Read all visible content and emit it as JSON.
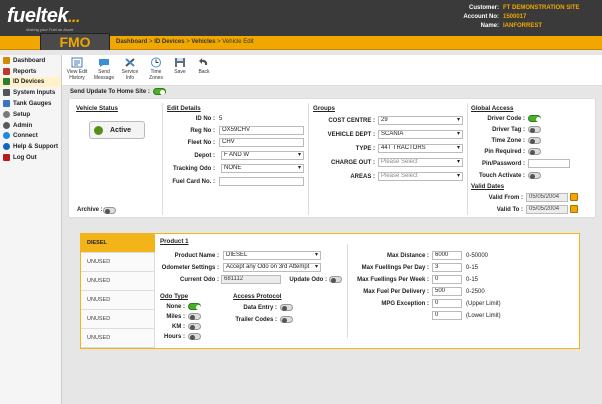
{
  "logo": {
    "text": "fueltek",
    "dots": "...",
    "tagline": "Making your Fuel an Asset"
  },
  "account": {
    "customer_label": "Customer:",
    "customer": "FT DEMONSTRATION SITE",
    "account_label": "Account No:",
    "account_no": "1500017",
    "name_label": "Name:",
    "name": "IANFORREST"
  },
  "app_tab": "FMO",
  "breadcrumb": {
    "home": "Dashboard",
    "id_devices": "ID Devices",
    "vehicles": "Vehicles",
    "current": "Vehicle Edit",
    "sep": " > "
  },
  "sidebar": [
    {
      "label": "Dashboard",
      "icon": "dashboard-icon",
      "color": "#d28a00"
    },
    {
      "label": "Reports",
      "icon": "reports-icon",
      "color": "#c0392b"
    },
    {
      "label": "ID Devices",
      "icon": "id-devices-icon",
      "color": "#2e7d32"
    },
    {
      "label": "System Inputs",
      "icon": "system-inputs-icon",
      "color": "#555555"
    },
    {
      "label": "Tank Gauges",
      "icon": "tank-gauges-icon",
      "color": "#3a75c4"
    },
    {
      "label": "Setup",
      "icon": "setup-icon",
      "color": "#7a7a7a"
    },
    {
      "label": "Admin",
      "icon": "admin-icon",
      "color": "#5a5a5a"
    },
    {
      "label": "Connect",
      "icon": "connect-icon",
      "color": "#1e88e5"
    },
    {
      "label": "Help & Support",
      "icon": "help-icon",
      "color": "#1565c0"
    },
    {
      "label": "Log Out",
      "icon": "log-out-icon",
      "color": "#b71c1c"
    }
  ],
  "toolbar": {
    "view_edit_history": [
      "View Edit",
      "History"
    ],
    "send_message": [
      "Send",
      "Message"
    ],
    "service_info": [
      "Service",
      "Info"
    ],
    "time_zones": [
      "Time",
      "Zones"
    ],
    "save": "Save",
    "back": "Back"
  },
  "send_update": {
    "label": "Send Update To Home Site :",
    "on": true
  },
  "vehicle_status": {
    "title": "Vehicle Status",
    "state": "Active",
    "archive_label": "Archive :",
    "archive_on": false
  },
  "edit_details": {
    "title": "Edit Details",
    "id_no_label": "ID No :",
    "id_no": "5",
    "reg_no_label": "Reg No :",
    "reg_no": "OX59CHV",
    "fleet_no_label": "Fleet No :",
    "fleet_no": "CHV",
    "depot_label": "Depot :",
    "depot": "F AND W",
    "tracking_odo_label": "Tracking Odo :",
    "tracking_odo": "NONE",
    "fuel_card_label": "Fuel Card No. :",
    "fuel_card": ""
  },
  "groups": {
    "title": "Groups",
    "cost_centre_label": "COST CENTRE :",
    "cost_centre": "29",
    "vehicle_dept_label": "VEHICLE DEPT :",
    "vehicle_dept": "SCANIA",
    "type_label": "TYPE :",
    "type": "44T TRACTORS",
    "charge_out_label": "CHARGE OUT :",
    "charge_out": "Please Select",
    "areas_label": "AREAS :",
    "areas": "Please Select"
  },
  "global_access": {
    "title": "Global Access",
    "driver_code_label": "Driver Code :",
    "driver_code_on": true,
    "driver_tag_label": "Driver Tag :",
    "driver_tag_on": false,
    "time_zone_label": "Time Zone :",
    "time_zone_on": false,
    "pin_required_label": "Pin Required :",
    "pin_required_on": false,
    "pin_password_label": "Pin/Password :",
    "pin_password": "",
    "touch_activate_label": "Touch Activate :",
    "touch_activate_on": false
  },
  "valid_dates": {
    "title": "Valid Dates",
    "from_label": "Valid From :",
    "from": "05/05/2004",
    "to_label": "Valid To :",
    "to": "05/05/2004"
  },
  "products": {
    "tabs": [
      "DIESEL",
      "UNUSED",
      "UNUSED",
      "UNUSED",
      "UNUSED",
      "UNUSED"
    ],
    "title": "Product 1",
    "product_name_label": "Product Name :",
    "product_name": "DIESEL",
    "odometer_settings_label": "Odometer Settings :",
    "odometer_settings": "Accept any Odo on 3rd Attempt",
    "current_odo_label": "Current Odo :",
    "current_odo": "681112",
    "update_odo_label": "Update Odo :",
    "update_odo_on": false,
    "odo_type_title": "Odo Type",
    "odo_none_label": "None :",
    "odo_none_on": true,
    "odo_miles_label": "Miles :",
    "odo_miles_on": false,
    "odo_km_label": "KM :",
    "odo_km_on": false,
    "odo_hours_label": "Hours :",
    "odo_hours_on": false,
    "access_protocol_title": "Access Protocol",
    "data_entry_label": "Data Entry :",
    "data_entry_on": false,
    "trailer_codes_label": "Trailer Codes :",
    "trailer_codes_on": false,
    "max_distance_label": "Max Distance :",
    "max_distance": "6000",
    "max_distance_range": "0-50000",
    "max_fuellings_day_label": "Max Fuellings Per Day :",
    "max_fuellings_day": "3",
    "max_fuellings_day_range": "0-15",
    "max_fuellings_week_label": "Max Fuellings Per Week :",
    "max_fuellings_week": "0",
    "max_fuellings_week_range": "0-15",
    "max_fuel_delivery_label": "Max Fuel Per Delivery :",
    "max_fuel_delivery": "500",
    "max_fuel_delivery_range": "0-2500",
    "mpg_exception_label": "MPG Exception :",
    "mpg_upper": "0",
    "mpg_upper_note": "(Upper Limit)",
    "mpg_lower": "0",
    "mpg_lower_note": "(Lower Limit)"
  },
  "colors": {
    "accent": "#f0a800",
    "header": "#3a3a3a",
    "toggle_on": "#4caf2a"
  }
}
